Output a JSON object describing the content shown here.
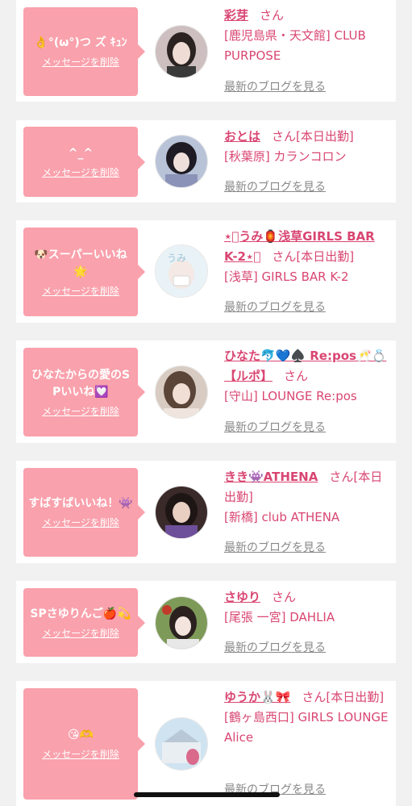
{
  "delete_label": "メッセージを削除",
  "blog_label": "最新のブログを見る",
  "honorific": "さん",
  "cards": [
    {
      "message": "👌°(ω°)つ ズ ｷｭﾝ",
      "name": "彩芽",
      "after_name": "",
      "shop": "[鹿児島県・天文館] CLUB PURPOSE"
    },
    {
      "message": "^_^",
      "name": "おとは",
      "after_name": "[本日出勤]",
      "shop": "[秋葉原] カランコロン"
    },
    {
      "message": "🐶スーパーいいね🌟",
      "name": "⋆͛うみ🏮浅草GIRLS BAR K-2⋆͛",
      "after_name": "[本日出勤]",
      "shop": "[浅草] GIRLS BAR K-2"
    },
    {
      "message": "ひなたからの愛のSPいいね💟",
      "name": "ひなた🐬💙♠️ Re:pos🥂💍【ルポ】",
      "after_name": "",
      "shop": "[守山] LOUNGE Re:pos"
    },
    {
      "message": "すばすばいいね！👾",
      "name": "きき👾ATHENA",
      "after_name": "[本日出勤]",
      "shop": "[新橋] club ATHENA"
    },
    {
      "message": "SPさゆりんご🍎💫",
      "name": "さゆり",
      "after_name": "",
      "shop": "[尾張 一宮] DAHLIA"
    },
    {
      "message": "😘🫶",
      "name": "ゆうか🐰🎀",
      "after_name": "[本日出勤]",
      "shop": "[鶴ヶ島西口] GIRLS LOUNGE Alice"
    }
  ]
}
